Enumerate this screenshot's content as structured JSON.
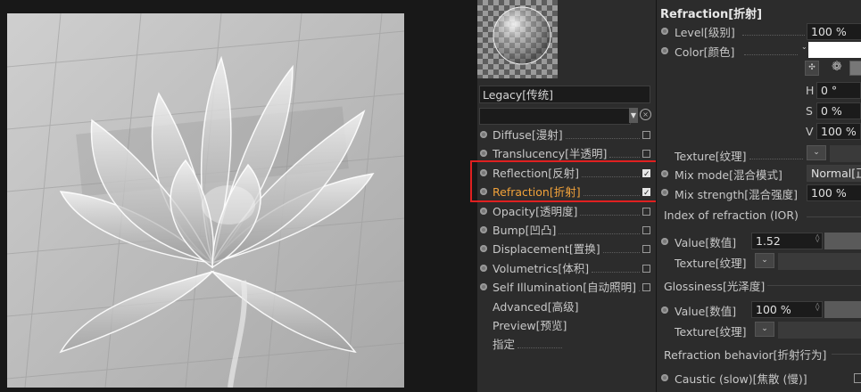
{
  "material_panel": {
    "preset": "Legacy[传统]",
    "channels": [
      {
        "label": "Diffuse[漫射]",
        "checked": false,
        "has_checkbox": true,
        "has_dot": true
      },
      {
        "label": "Translucency[半透明]",
        "checked": false,
        "has_checkbox": true,
        "has_dot": true
      },
      {
        "label": "Reflection[反射]",
        "checked": true,
        "has_checkbox": true,
        "has_dot": true
      },
      {
        "label": "Refraction[折射]",
        "checked": true,
        "has_checkbox": true,
        "has_dot": true,
        "active": true
      },
      {
        "label": "Opacity[透明度]",
        "checked": false,
        "has_checkbox": true,
        "has_dot": true
      },
      {
        "label": "Bump[凹凸]",
        "checked": false,
        "has_checkbox": true,
        "has_dot": true
      },
      {
        "label": "Displacement[置换]",
        "checked": false,
        "has_checkbox": true,
        "has_dot": true
      },
      {
        "label": "Volumetrics[体积]",
        "checked": false,
        "has_checkbox": true,
        "has_dot": true
      },
      {
        "label": "Self Illumination[自动照明]",
        "checked": false,
        "has_checkbox": true,
        "has_dot": true
      },
      {
        "label": "Advanced[高级]",
        "has_checkbox": false,
        "has_dot": false
      },
      {
        "label": "Preview[预览]",
        "has_checkbox": false,
        "has_dot": false
      },
      {
        "label": "指定",
        "has_checkbox": false,
        "has_dot": false
      }
    ]
  },
  "refraction": {
    "title": "Refraction[折射]",
    "level_label": "Level[级别]",
    "level_value": "100 %",
    "color_label": "Color[颜色]",
    "color_value": "#ffffff",
    "h_label": "H",
    "h_value": "0 °",
    "s_label": "S",
    "s_value": "0 %",
    "v_label": "V",
    "v_value": "100 %",
    "texture_label": "Texture[纹理]",
    "mix_mode_label": "Mix mode[混合模式]",
    "mix_mode_value": "Normal[正",
    "mix_strength_label": "Mix strength[混合强度]",
    "mix_strength_value": "100 %",
    "ior_group": "Index of refraction (IOR)",
    "ior_value_label": "Value[数值]",
    "ior_value": "1.52",
    "ior_texture_label": "Texture[纹理]",
    "gloss_group": "Glossiness[光泽度]",
    "gloss_value_label": "Value[数值]",
    "gloss_value": "100 %",
    "gloss_texture_label": "Texture[纹理]",
    "behavior_group": "Refraction behavior[折射行为]",
    "caustic_label": "Caustic (slow)[焦散 (慢)]"
  },
  "colors": {
    "accent_active": "#f0a23a",
    "highlight_box": "#e02020",
    "panel_bg": "#2c2c2c"
  }
}
